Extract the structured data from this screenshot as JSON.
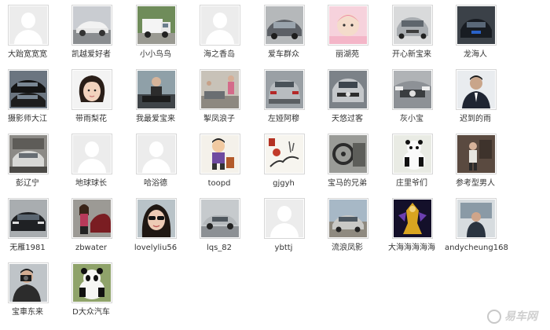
{
  "members": [
    {
      "name": "大跆宽宽宽",
      "avatar": "default-avatar"
    },
    {
      "name": "凯越爱好者",
      "avatar": "silver-car-photo"
    },
    {
      "name": "小小鸟鸟",
      "avatar": "white-truck-photo"
    },
    {
      "name": "海之香岛",
      "avatar": "default-avatar"
    },
    {
      "name": "爱车群众",
      "avatar": "grey-car-photo"
    },
    {
      "name": "丽湖苑",
      "avatar": "baby-photo"
    },
    {
      "name": "开心新宝来",
      "avatar": "silver-sedan-photo"
    },
    {
      "name": "龙海人",
      "avatar": "dark-car-photo"
    },
    {
      "name": "摄影师大江",
      "avatar": "black-cars-photo"
    },
    {
      "name": "带雨梨花",
      "avatar": "woman-portrait-photo"
    },
    {
      "name": "我最爱宝来",
      "avatar": "man-on-car-photo"
    },
    {
      "name": "掣凤浪子",
      "avatar": "people-garage-photo"
    },
    {
      "name": "左娅阿穆",
      "avatar": "car-rear-photo"
    },
    {
      "name": "天悠过客",
      "avatar": "car-front-photo"
    },
    {
      "name": "灰小宝",
      "avatar": "car-grille-photo"
    },
    {
      "name": "迟到的雨",
      "avatar": "man-suit-photo"
    },
    {
      "name": "彭辽宁",
      "avatar": "car-garage-photo"
    },
    {
      "name": "地球球长",
      "avatar": "default-avatar"
    },
    {
      "name": "哈浴德",
      "avatar": "default-avatar"
    },
    {
      "name": "toopd",
      "avatar": "cartoon-man-photo"
    },
    {
      "name": "gjgyh",
      "avatar": "ink-painting-photo"
    },
    {
      "name": "宝马的兄弟",
      "avatar": "car-interior-photo"
    },
    {
      "name": "庄里爷们",
      "avatar": "panda-photo"
    },
    {
      "name": "参考型男人",
      "avatar": "person-room-photo"
    },
    {
      "name": "无雁1981",
      "avatar": "dark-sedan-photo"
    },
    {
      "name": "zbwater",
      "avatar": "woman-car-photo"
    },
    {
      "name": "lovelyliu56",
      "avatar": "woman-sunglasses-photo"
    },
    {
      "name": "lqs_82",
      "avatar": "silver-car-side-photo"
    },
    {
      "name": "ybttj",
      "avatar": "default-avatar"
    },
    {
      "name": "流浪凤影",
      "avatar": "car-outdoor-photo"
    },
    {
      "name": "大海海海海海",
      "avatar": "gold-figure-photo"
    },
    {
      "name": "andycheung168",
      "avatar": "man-poster-photo"
    },
    {
      "name": "宝車东来",
      "avatar": "photographer-photo"
    },
    {
      "name": "D大众汽车",
      "avatar": "panda-cub-photo"
    }
  ],
  "watermark": {
    "text": "易车网"
  }
}
